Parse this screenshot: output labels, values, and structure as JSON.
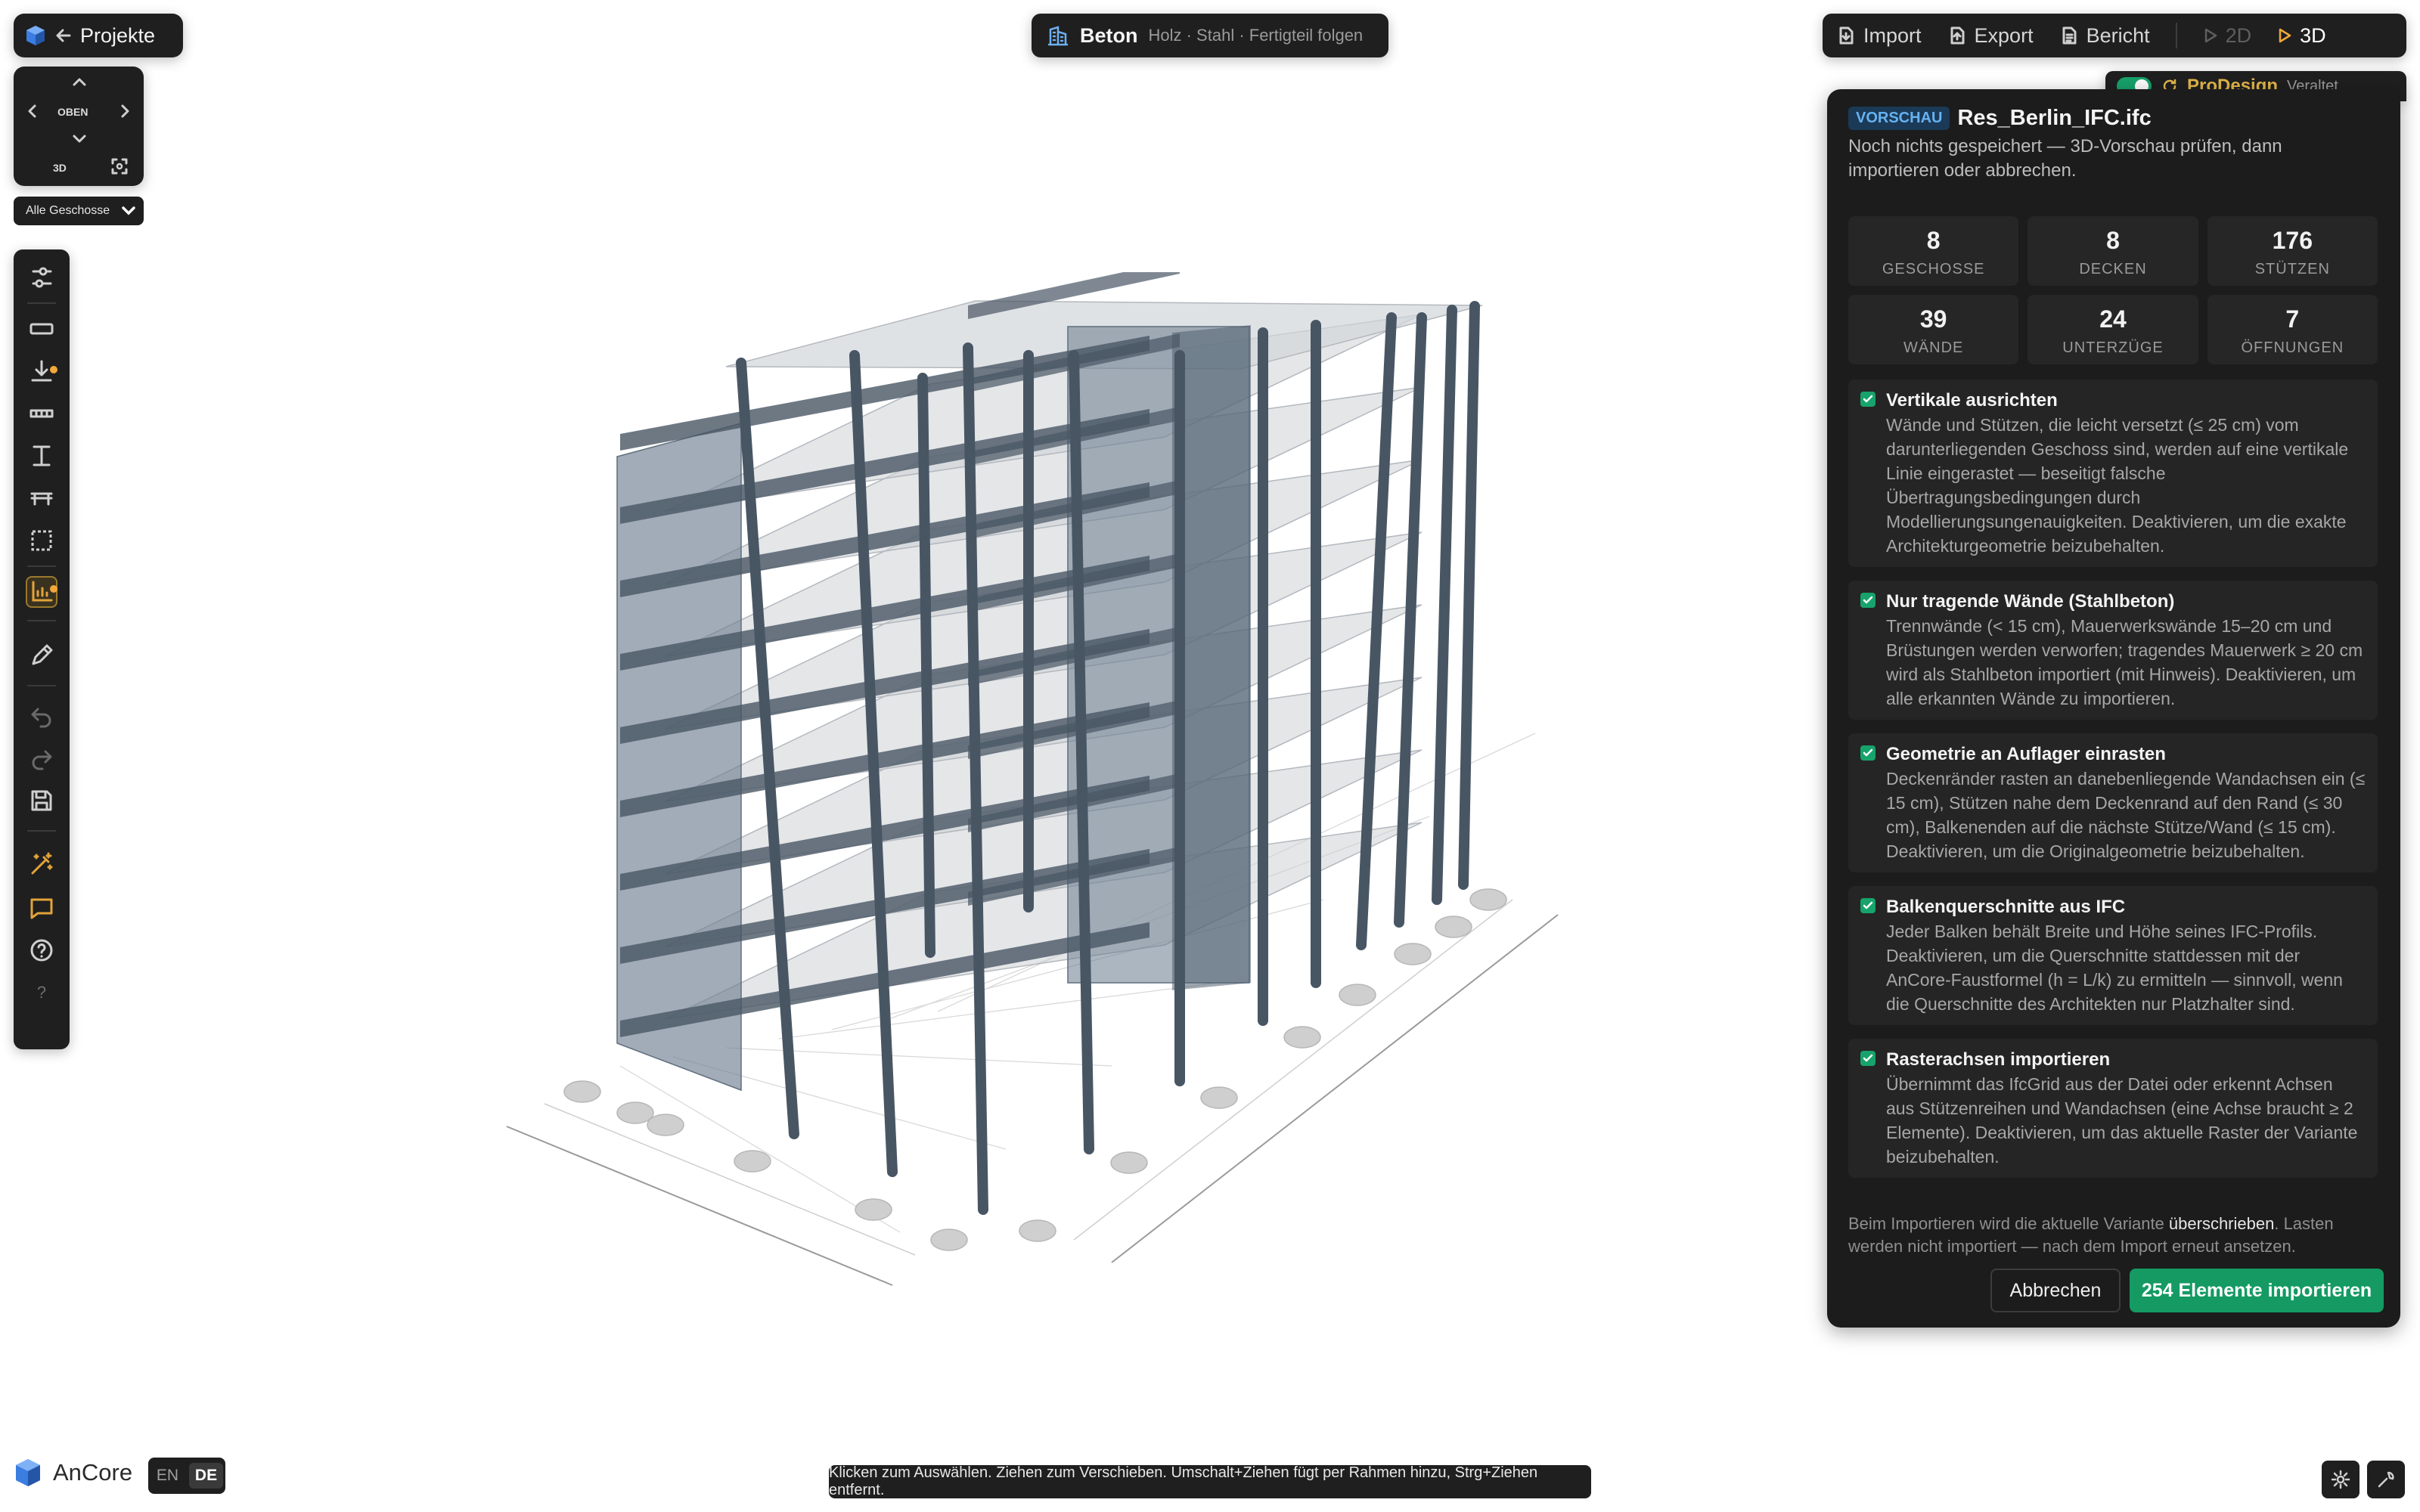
{
  "header": {
    "back_label": "Projekte",
    "viewcube": {
      "face_label": "OBEN",
      "mode_label": "3D"
    },
    "storey_select": "Alle Geschosse",
    "material": {
      "active": "Beton",
      "rest": "Holz · Stahl · Fertigteil folgen"
    },
    "actions": {
      "import": "Import",
      "export": "Export",
      "report": "Bericht",
      "view_2d": "2D",
      "view_3d": "3D"
    },
    "prodesign": {
      "label": "ProDesign",
      "status": "Veraltet"
    }
  },
  "import_panel": {
    "badge": "VORSCHAU",
    "filename": "Res_Berlin_IFC.ifc",
    "subtitle": "Noch nichts gespeichert — 3D-Vorschau prüfen, dann importieren oder abbrechen.",
    "stats": [
      {
        "value": "8",
        "label": "GESCHOSSE"
      },
      {
        "value": "8",
        "label": "DECKEN"
      },
      {
        "value": "176",
        "label": "STÜTZEN"
      },
      {
        "value": "39",
        "label": "WÄNDE"
      },
      {
        "value": "24",
        "label": "UNTERZÜGE"
      },
      {
        "value": "7",
        "label": "ÖFFNUNGEN"
      }
    ],
    "options": [
      {
        "title": "Vertikale ausrichten",
        "checked": true,
        "description": "Wände und Stützen, die leicht versetzt (≤ 25 cm) vom darunterliegenden Geschoss sind, werden auf eine vertikale Linie eingerastet — beseitigt falsche Übertragungsbedingungen durch Modellierungsungenauigkeiten. Deaktivieren, um die exakte Architekturgeometrie beizubehalten."
      },
      {
        "title": "Nur tragende Wände (Stahlbeton)",
        "checked": true,
        "description": "Trennwände (< 15 cm), Mauerwerkswände 15–20 cm und Brüstungen werden verworfen; tragendes Mauerwerk ≥ 20 cm wird als Stahlbeton importiert (mit Hinweis). Deaktivieren, um alle erkannten Wände zu importieren."
      },
      {
        "title": "Geometrie an Auflager einrasten",
        "checked": true,
        "description": "Deckenränder rasten an danebenliegende Wandachsen ein (≤ 15 cm), Stützen nahe dem Deckenrand auf den Rand (≤ 30 cm), Balkenenden auf die nächste Stütze/Wand (≤ 15 cm). Deaktivieren, um die Originalgeometrie beizubehalten."
      },
      {
        "title": "Balkenquerschnitte aus IFC",
        "checked": true,
        "description": "Jeder Balken behält Breite und Höhe seines IFC-Profils. Deaktivieren, um die Querschnitte stattdessen mit der AnCore-Faustformel (h = L/k) zu ermitteln — sinnvoll, wenn die Querschnitte des Architekten nur Platzhalter sind."
      },
      {
        "title": "Rasterachsen importieren",
        "checked": true,
        "description": "Übernimmt das IfcGrid aus der Datei oder erkennt Achsen aus Stützenreihen und Wandachsen (eine Achse braucht ≥ 2 Elemente). Deaktivieren, um das aktuelle Raster der Variante beizubehalten."
      }
    ],
    "footer_pre": "Beim Importieren wird die aktuelle Variante ",
    "footer_bold": "überschrieben",
    "footer_post": ". Lasten werden nicht importiert — nach dem Import erneut ansetzen.",
    "cancel_label": "Abbrechen",
    "import_label": "254 Elemente importieren"
  },
  "footer": {
    "brand": "AnCore",
    "lang": [
      "EN",
      "DE"
    ],
    "active_lang": "DE",
    "hint": "Klicken zum Auswählen. Ziehen zum Verschieben. Umschalt+Ziehen fügt per Rahmen hinzu, Strg+Ziehen entfernt."
  },
  "colors": {
    "accent_green": "#149a62",
    "badge_blue": "#67b2f0",
    "prodesign_gold": "#e4b64a",
    "notification": "#f2a83b"
  },
  "icons": [
    "projects-logo",
    "back-arrow-icon",
    "sliders-icon",
    "slab-icon",
    "download-icon",
    "beam-icon",
    "column-icon",
    "table-icon",
    "selection-icon",
    "chart-icon",
    "pencil-icon",
    "undo-icon",
    "redo-icon",
    "save-icon",
    "magic-wand-icon",
    "comment-icon",
    "help-icon",
    "settings-icon",
    "wrench-icon"
  ]
}
